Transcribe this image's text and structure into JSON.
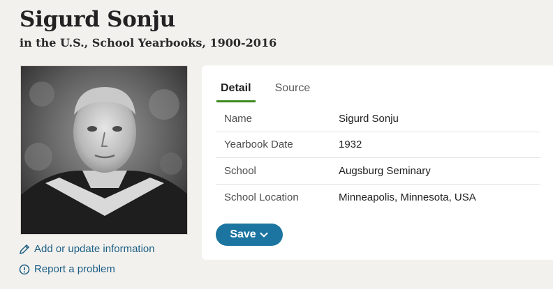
{
  "header": {
    "name": "Sigurd Sonju",
    "collection": "in the U.S., School Yearbooks, 1900-2016"
  },
  "photo": {
    "icon": "yearbook-portrait"
  },
  "sidebar": {
    "add_update": "Add or update information",
    "report": "Report a problem"
  },
  "tabs": [
    {
      "label": "Detail",
      "active": true
    },
    {
      "label": "Source",
      "active": false
    }
  ],
  "details": [
    {
      "label": "Name",
      "value": "Sigurd Sonju"
    },
    {
      "label": "Yearbook Date",
      "value": "1932"
    },
    {
      "label": "School",
      "value": "Augsburg Seminary"
    },
    {
      "label": "School Location",
      "value": "Minneapolis, Minnesota, USA"
    }
  ],
  "actions": {
    "save_label": "Save"
  },
  "colors": {
    "background": "#f3f1ee",
    "link": "#1b5e84",
    "tab_accent": "#3c8a1f",
    "save_button": "#1b75a0"
  }
}
